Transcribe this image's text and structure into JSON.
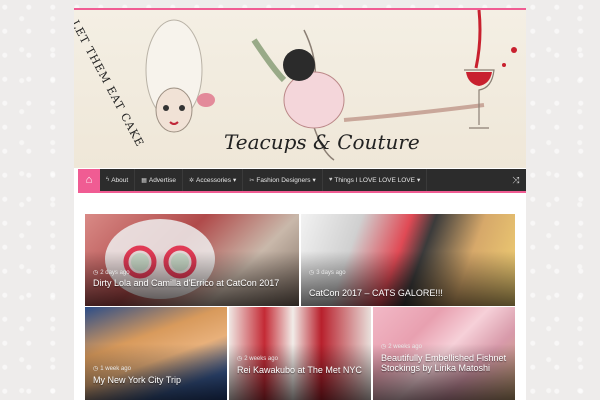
{
  "header": {
    "site_title": "Teacups & Couture",
    "tagline": "LET THEM EAT CAKE",
    "accent_color": "#f05c93"
  },
  "nav": {
    "home_icon": "home-icon",
    "items": [
      {
        "label": "About",
        "icon": "bolt-icon",
        "caret": ""
      },
      {
        "label": "Advertise",
        "icon": "grid-icon",
        "caret": ""
      },
      {
        "label": "Accessories",
        "icon": "gear-icon",
        "caret": "▾"
      },
      {
        "label": "Fashion Designers",
        "icon": "scissors-icon",
        "caret": "▾"
      },
      {
        "label": "Things I LOVE LOVE LOVE",
        "icon": "heart-icon",
        "caret": "▾"
      }
    ],
    "random_icon": "shuffle-icon"
  },
  "posts": [
    {
      "date": "2 days ago",
      "title": "Dirty Lola and Camilla d'Errico at CatCon 2017"
    },
    {
      "date": "3 days ago",
      "title": "CatCon 2017 – CATS GALORE!!!"
    },
    {
      "date": "1 week ago",
      "title": "My New York City Trip"
    },
    {
      "date": "2 weeks ago",
      "title": "Rei Kawakubo at The Met NYC"
    },
    {
      "date": "2 weeks ago",
      "title": "Beautifully Embellished Fishnet Stockings by Lirika Matoshi"
    }
  ]
}
